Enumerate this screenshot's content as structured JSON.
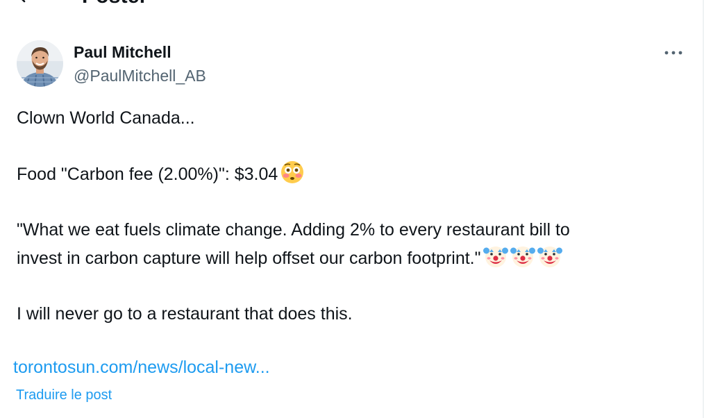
{
  "header": {
    "title": "Poster",
    "back_icon": "back-arrow-icon"
  },
  "author": {
    "name": "Paul Mitchell",
    "handle": "@PaulMitchell_AB",
    "avatar_icon": "avatar-photo"
  },
  "more_icon": "more-dots-icon",
  "tweet": {
    "line1": "Clown World Canada...",
    "line2": "Food \"Carbon fee (2.00%)\": $3.04",
    "line2_emoji": "flushed-face-icon",
    "line3a": "\"What we eat fuels climate change. Adding 2% to every restaurant bill to",
    "line3b": "invest in carbon capture will help offset our carbon footprint.\"",
    "line3_emoji": "clown-face-icon",
    "line4": "I will never go to a restaurant that does this."
  },
  "link_text": "torontosun.com/news/local-new...",
  "translate_label": "Traduire le post",
  "colors": {
    "link": "#1d9bf0",
    "text": "#0f1419",
    "secondary": "#536471"
  }
}
